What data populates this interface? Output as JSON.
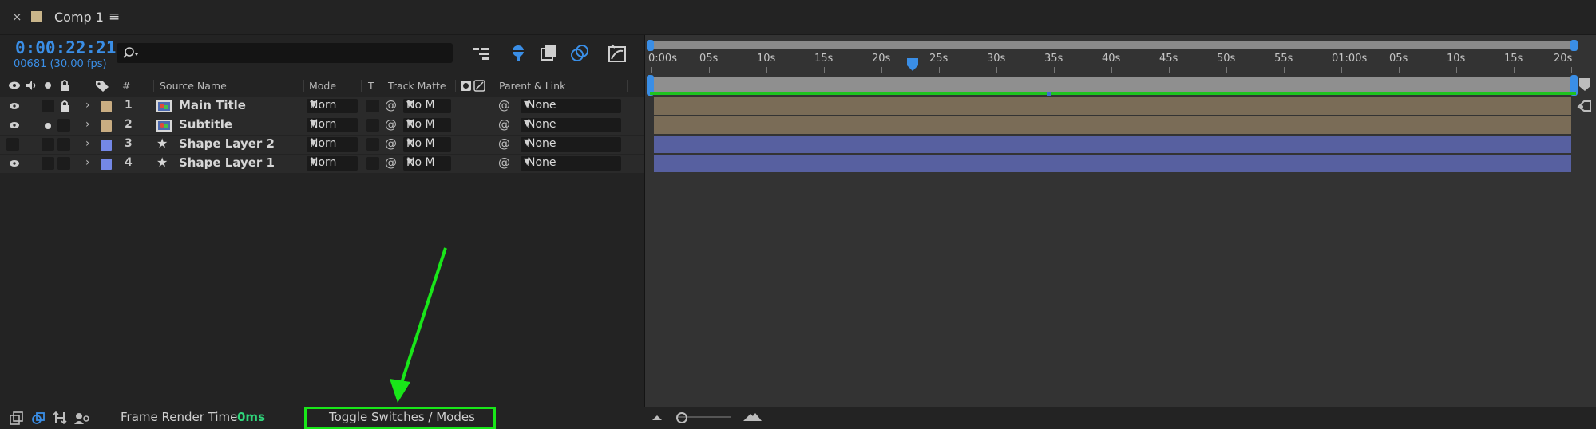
{
  "tab": {
    "close": "×",
    "title": "Comp 1",
    "menu": "≡",
    "swatch_color": "#c9b58a"
  },
  "time": {
    "current": "0:00:22:21",
    "frames": "00681 (30.00 fps)"
  },
  "search": {
    "placeholder": ""
  },
  "headers": {
    "number": "#",
    "source_name": "Source Name",
    "mode": "Mode",
    "t": "T",
    "track_matte": "Track Matte",
    "parent_link": "Parent & Link"
  },
  "layers": [
    {
      "number": "1",
      "name": "Main Title",
      "type": "comp",
      "color": "#c9ad82",
      "mode": "Norn",
      "matte": "No M",
      "parent": "None",
      "eye": true,
      "audio": false,
      "solo": false,
      "lock": true
    },
    {
      "number": "2",
      "name": "Subtitle",
      "type": "comp",
      "color": "#c9ad82",
      "mode": "Norn",
      "matte": "No M",
      "parent": "None",
      "eye": true,
      "audio": false,
      "solo": true,
      "lock": false
    },
    {
      "number": "3",
      "name": "Shape Layer 2",
      "type": "shape",
      "color": "#7488e6",
      "mode": "Norn",
      "matte": "No M",
      "parent": "None",
      "eye": false,
      "audio": false,
      "solo": false,
      "lock": false
    },
    {
      "number": "4",
      "name": "Shape Layer 1",
      "type": "shape",
      "color": "#7488e6",
      "mode": "Norn",
      "matte": "No M",
      "parent": "None",
      "eye": true,
      "audio": false,
      "solo": false,
      "lock": false
    }
  ],
  "ruler": {
    "labels": [
      "0:00s",
      "05s",
      "10s",
      "15s",
      "20s",
      "25s",
      "30s",
      "35s",
      "40s",
      "45s",
      "50s",
      "55s",
      "01:00s",
      "05s",
      "10s",
      "15s",
      "20s"
    ],
    "playhead_seconds": 22.7,
    "total_seconds": 80
  },
  "footer": {
    "frame_render_label": "Frame Render Time",
    "frame_render_value": "0ms",
    "toggle": "Toggle Switches / Modes"
  },
  "colors": {
    "accent": "#3a8ee6",
    "highlight": "#19e619",
    "work_area": "#1fc21f"
  }
}
